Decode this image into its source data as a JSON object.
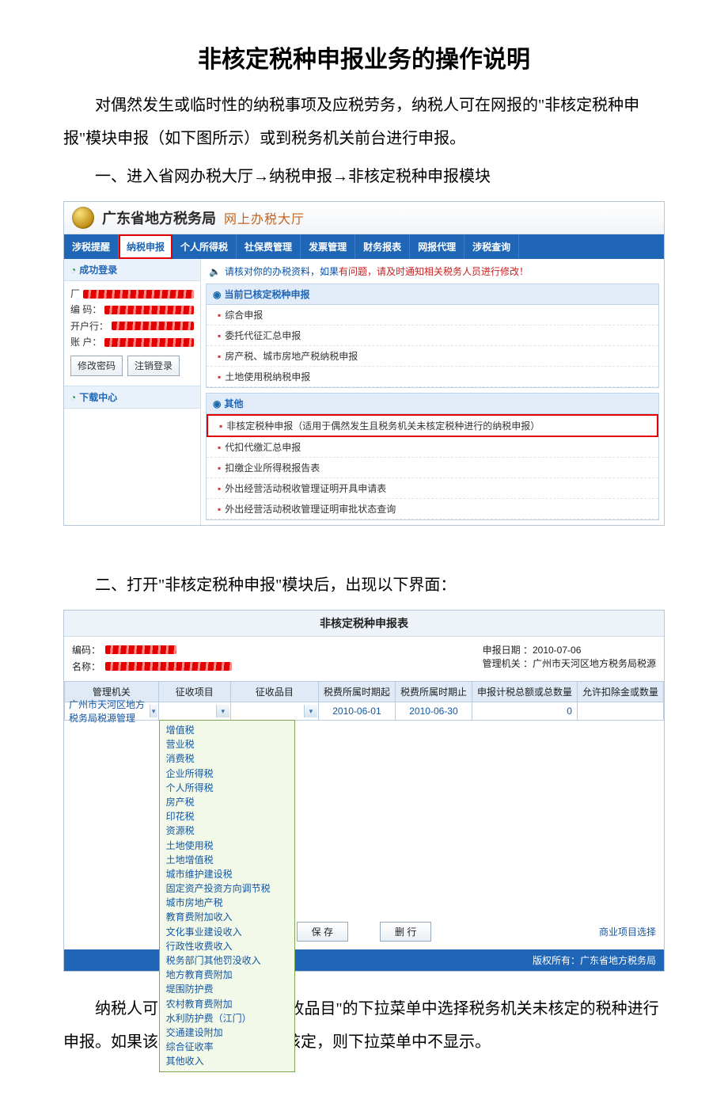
{
  "doc": {
    "title": "非核定税种申报业务的操作说明",
    "intro": "对偶然发生或临时性的纳税事项及应税劳务，纳税人可在网报的\"非核定税种申报\"模块申报（如下图所示）或到税务机关前台进行申报。",
    "step1": "一、进入省网办税大厅→纳税申报→非核定税种申报模块",
    "step2": "二、打开\"非核定税种申报\"模块后，出现以下界面：",
    "outro": "纳税人可在\"征收项目\"和\"征收品目\"的下拉菜单中选择税务机关未核定的税种进行申报。如果该税种税务机关已经核定，则下拉菜单中不显示。"
  },
  "ss1": {
    "brand": "广东省地方税务局",
    "brand_sub": "网上办税大厅",
    "nav": [
      "涉税提醒",
      "纳税申报",
      "个人所得税",
      "社保费管理",
      "发票管理",
      "财务报表",
      "网报代理",
      "涉税查询"
    ],
    "active_nav_index": 1,
    "login_panel": "成功登录",
    "login_fields": {
      "a": "厂",
      "b": "编 码：",
      "c": "开户行：",
      "d": "账 户："
    },
    "btn_modify": "修改密码",
    "btn_logout": "注销登录",
    "dl_center": "下载中心",
    "notice_pre": "请核对你的办税资料，如果",
    "notice_red": "有问题，请及时通知相关税务人员进行修改！",
    "sec1_title": "当前已核定税种申报",
    "sec1_items": [
      "综合申报",
      "委托代征汇总申报",
      "房产税、城市房地产税纳税申报",
      "土地使用税纳税申报"
    ],
    "sec2_title": "其他",
    "sec2_items": [
      "非核定税种申报（适用于偶然发生且税务机关未核定税种进行的纳税申报）",
      "代扣代缴汇总申报",
      "扣缴企业所得税报告表",
      "外出经营活动税收管理证明开具申请表",
      "外出经营活动税收管理证明审批状态查询"
    ],
    "sec2_highlight_index": 0
  },
  "ss2": {
    "form_title": "非核定税种申报表",
    "label_code": "编码：",
    "label_name": "名称：",
    "label_date": "申报日期 ：",
    "value_date": "2010-07-06",
    "label_auth": "管理机关 ：",
    "value_auth": "广州市天河区地方税务局税源",
    "cols": [
      "管理机关",
      "征收项目",
      "征收品目",
      "税费所属时期起",
      "税费所属时期止",
      "申报计税总额或总数量",
      "允许扣除金或数量"
    ],
    "row": {
      "authority": "广州市天河区地方税务局税源管理",
      "period_start": "2010-06-01",
      "period_end": "2010-06-30",
      "total": "0"
    },
    "btn_save": "保 存",
    "btn_del": "删 行",
    "link_right": "商业项目选择",
    "footer": "版权所有：广东省地方税务局",
    "dropdown": [
      "增值税",
      "营业税",
      "消费税",
      "企业所得税",
      "个人所得税",
      "房产税",
      "印花税",
      "资源税",
      "土地使用税",
      "土地增值税",
      "城市维护建设税",
      "固定资产投资方向调节税",
      "城市房地产税",
      "教育费附加收入",
      "文化事业建设收入",
      "行政性收费收入",
      "税务部门其他罚没收入",
      "地方教育费附加",
      "堤围防护费",
      "农村教育费附加",
      "水利防护费（江门）",
      "交通建设附加",
      "综合征收率",
      "其他收入"
    ]
  }
}
